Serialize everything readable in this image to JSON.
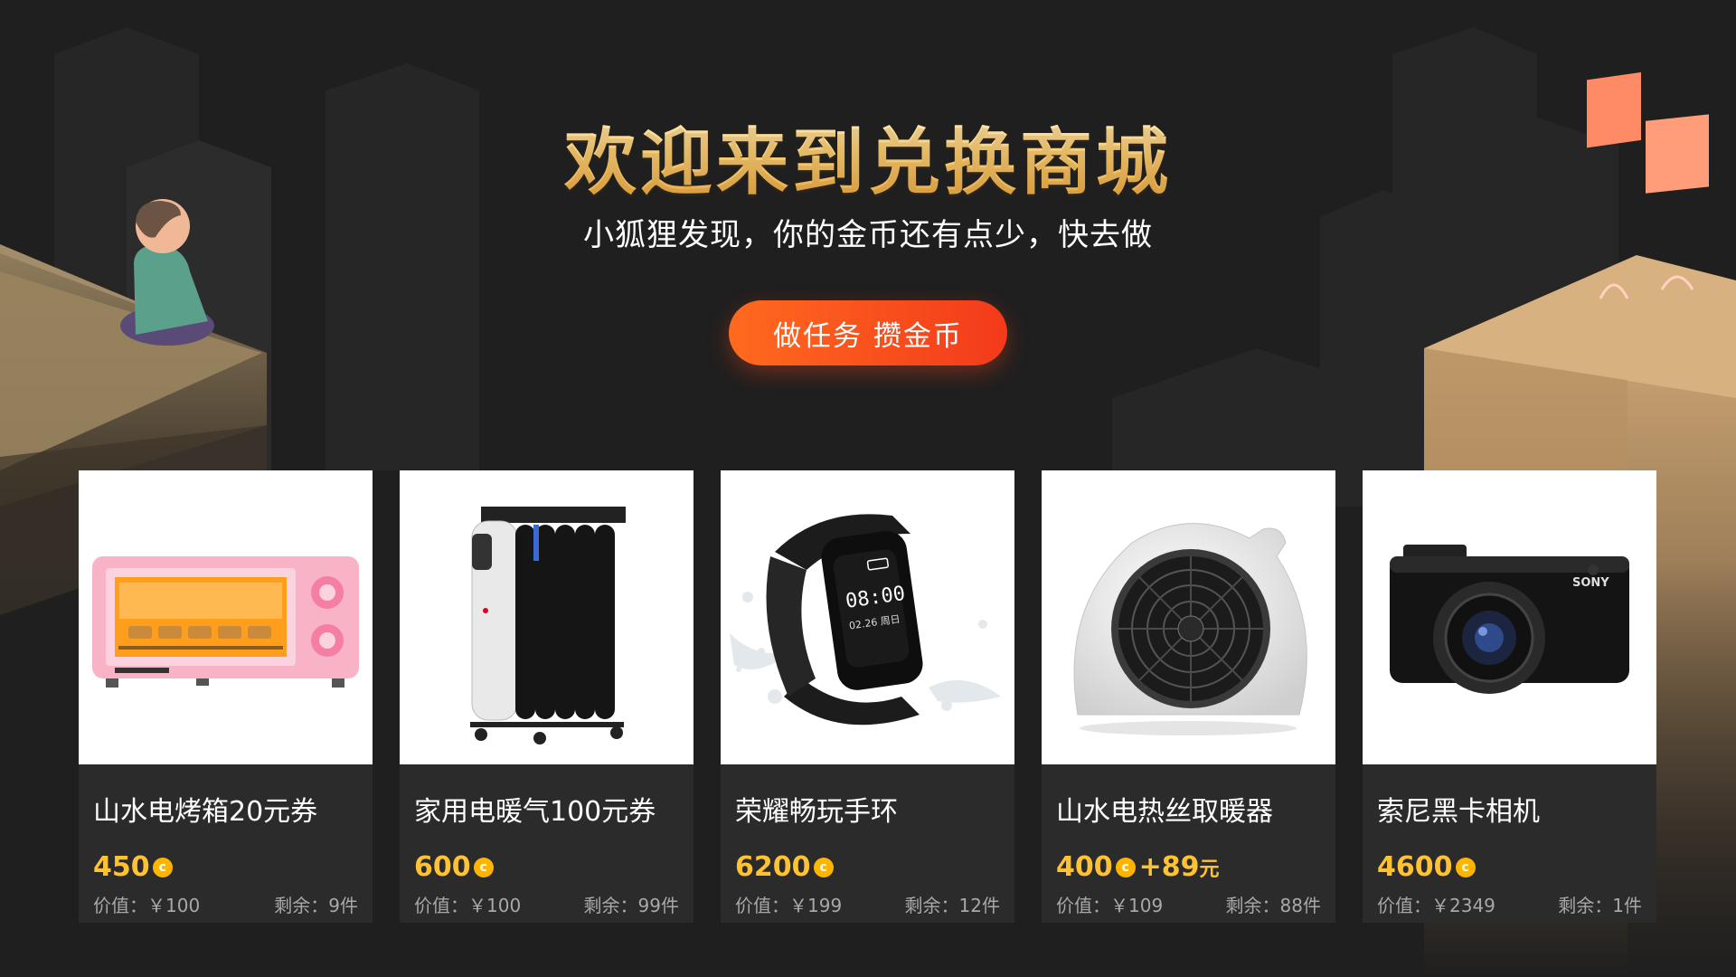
{
  "header": {
    "title": "欢迎来到兑换商城",
    "subtitle": "小狐狸发现，你的金币还有点少，快去做",
    "cta_label": "做任务  攒金币"
  },
  "colors": {
    "background": "#1f1f1f",
    "accent": "#ff5a1f",
    "coin": "#ffb400",
    "price": "#ffc233",
    "card": "#2b2b2b"
  },
  "coin_symbol": "c",
  "products": [
    {
      "name": "山水电烤箱20元券",
      "price": "450",
      "extra": "",
      "extra_unit": "",
      "value": "价值：￥100",
      "stock": "剩余：9件",
      "icon": "toaster-oven"
    },
    {
      "name": "家用电暖气100元券",
      "price": "600",
      "extra": "",
      "extra_unit": "",
      "value": "价值：￥100",
      "stock": "剩余：99件",
      "icon": "oil-heater"
    },
    {
      "name": "荣耀畅玩手环",
      "price": "6200",
      "extra": "",
      "extra_unit": "",
      "value": "价值：￥199",
      "stock": "剩余：12件",
      "icon": "smart-band"
    },
    {
      "name": "山水电热丝取暖器",
      "price": "400",
      "extra": "+89",
      "extra_unit": "元",
      "value": "价值：￥109",
      "stock": "剩余：88件",
      "icon": "fan-heater"
    },
    {
      "name": "索尼黑卡相机",
      "price": "4600",
      "extra": "",
      "extra_unit": "",
      "value": "价值：￥2349",
      "stock": "剩余：1件",
      "icon": "camera"
    }
  ],
  "product_texts": {
    "band_time": "08:00",
    "band_date": "02.26 周日",
    "camera_brand": "SONY"
  }
}
